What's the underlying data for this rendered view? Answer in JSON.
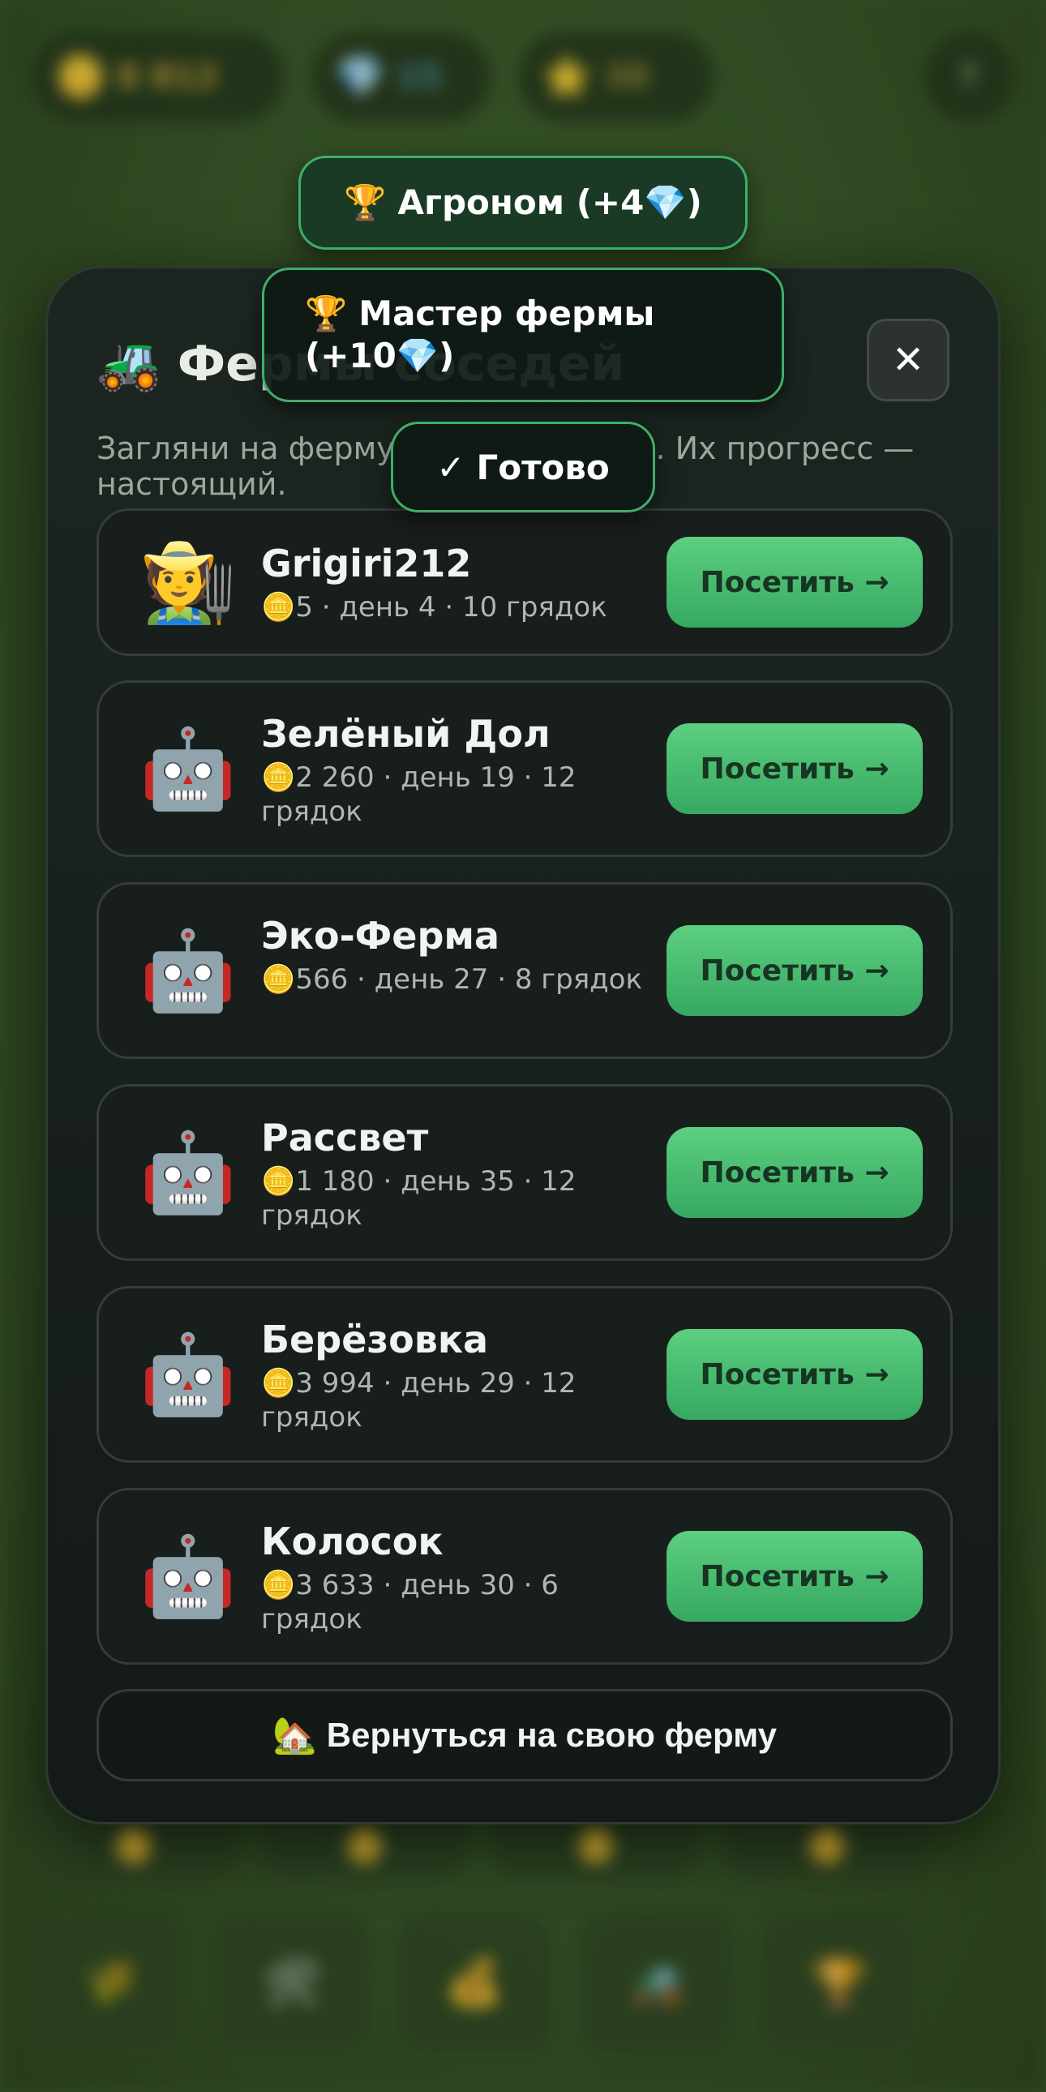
{
  "background": {
    "hud": {
      "coins": "8 812",
      "gems": "15",
      "stars": "38",
      "help": "?"
    }
  },
  "toasts": [
    {
      "icon": "🏆",
      "text": "Агроном (+4💎)"
    },
    {
      "icon": "🏆",
      "text": "Мастер фермы (+10💎)"
    },
    {
      "icon": "✓",
      "text": "Готово"
    }
  ],
  "modal": {
    "icon": "🚜",
    "title": "Фермы соседей",
    "close_label": "✕",
    "subtitle": "Загляни на ферму другого игрока. Их прогресс — настоящий.",
    "visit_label": "Посетить →",
    "farms": [
      {
        "avatar": "🧑‍🌾",
        "name": "Grigiri212",
        "meta": "🪙5 · день 4 · 10 грядок"
      },
      {
        "avatar": "🤖",
        "name": "Зелёный Дол",
        "meta": "🪙2 260 · день 19 · 12 грядок"
      },
      {
        "avatar": "🤖",
        "name": "Эко-Ферма",
        "meta": "🪙566 · день 27 · 8 грядок"
      },
      {
        "avatar": "🤖",
        "name": "Рассвет",
        "meta": "🪙1 180 · день 35 · 12 грядок"
      },
      {
        "avatar": "🤖",
        "name": "Берёзовка",
        "meta": "🪙3 994 · день 29 · 12 грядок"
      },
      {
        "avatar": "🤖",
        "name": "Колосок",
        "meta": "🪙3 633 · день 30 · 6 грядок"
      }
    ],
    "return_icon": "🏡",
    "return_label": "Вернуться на свою ферму"
  }
}
